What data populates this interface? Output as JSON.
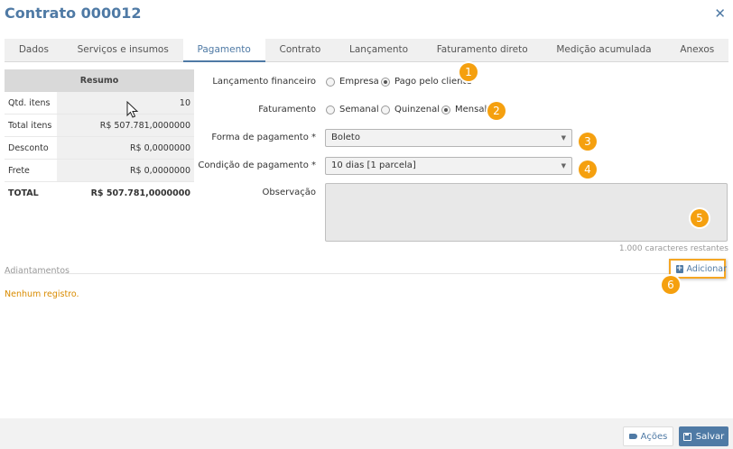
{
  "window": {
    "title": "Contrato 000012",
    "close_icon": "close-icon"
  },
  "tabs": [
    {
      "label": "Dados"
    },
    {
      "label": "Serviços e insumos"
    },
    {
      "label": "Pagamento"
    },
    {
      "label": "Contrato"
    },
    {
      "label": "Lançamento"
    },
    {
      "label": "Faturamento direto"
    },
    {
      "label": "Medição acumulada"
    },
    {
      "label": "Anexos"
    }
  ],
  "active_tab": "Pagamento",
  "summary": {
    "header": "Resumo",
    "rows": [
      {
        "label": "Qtd. itens",
        "value": "10"
      },
      {
        "label": "Total itens",
        "value": "R$ 507.781,0000000"
      },
      {
        "label": "Desconto",
        "value": "R$ 0,0000000"
      },
      {
        "label": "Frete",
        "value": "R$ 0,0000000"
      },
      {
        "label": "TOTAL",
        "value": "R$ 507.781,0000000"
      }
    ]
  },
  "form": {
    "lancamento": {
      "label": "Lançamento financeiro",
      "options": [
        "Empresa",
        "Pago pelo cliente"
      ],
      "selected": "Pago pelo cliente"
    },
    "faturamento": {
      "label": "Faturamento",
      "options": [
        "Semanal",
        "Quinzenal",
        "Mensal"
      ],
      "selected": "Mensal"
    },
    "forma": {
      "label": "Forma de pagamento *",
      "value": "Boleto"
    },
    "condicao": {
      "label": "Condição de pagamento *",
      "value": "10 dias [1 parcela]"
    },
    "observacao": {
      "label": "Observação",
      "value": "",
      "counter": "1.000 caracteres restantes"
    }
  },
  "adiantamentos": {
    "title": "Adiantamentos",
    "add_label": "Adicionar",
    "empty_text": "Nenhum registro."
  },
  "footer": {
    "acoes_label": "Ações",
    "salvar_label": "Salvar"
  },
  "badges": [
    "1",
    "2",
    "3",
    "4",
    "5",
    "6"
  ],
  "colors": {
    "accent": "#4f7aa5",
    "badge": "#f5a00f",
    "empty_text": "#d98b00"
  }
}
